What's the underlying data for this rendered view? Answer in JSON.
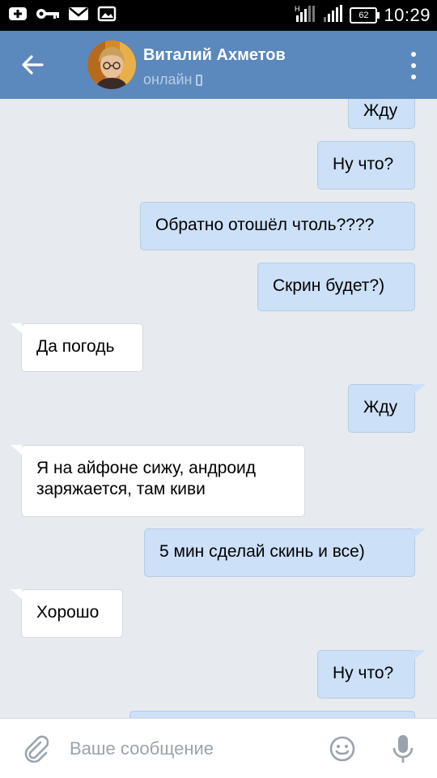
{
  "status_bar": {
    "battery": "62",
    "time": "10:29"
  },
  "header": {
    "contact_name": "Виталий Ахметов",
    "presence": "онлайн"
  },
  "messages": [
    {
      "direction": "out",
      "text": "Жду"
    },
    {
      "direction": "out",
      "text": "Ну что?"
    },
    {
      "direction": "out",
      "text": "Обратно отошёл чтоль????"
    },
    {
      "direction": "out",
      "text": "Скрин будет?)"
    },
    {
      "direction": "in",
      "text": "Да погодь"
    },
    {
      "direction": "out",
      "text": "Жду"
    },
    {
      "direction": "in",
      "text": "Я на айфоне сижу, андроид заряжается, там киви"
    },
    {
      "direction": "out",
      "text": "5 мин сделай скинь и все)"
    },
    {
      "direction": "in",
      "text": "Хорошо"
    },
    {
      "direction": "out",
      "text": "Ну что?"
    },
    {
      "direction": "out",
      "text": ""
    }
  ],
  "input": {
    "placeholder": "Ваше сообщение",
    "value": ""
  },
  "colors": {
    "header": "#5b88bd",
    "background": "#e7ebf0",
    "outgoing_bubble": "#cce0f7",
    "incoming_bubble": "#ffffff"
  }
}
